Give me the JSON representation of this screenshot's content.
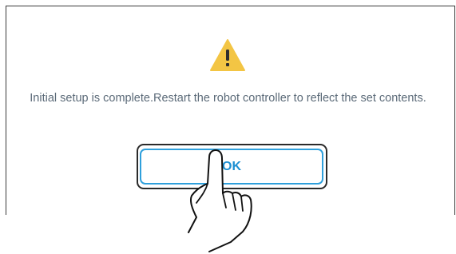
{
  "dialog": {
    "message": "Initial setup is complete.Restart the robot controller to reflect the set contents.",
    "ok_label": "OK",
    "icon": "warning-icon",
    "accent_color": "#1d8fd2",
    "warning_color": "#f3c544"
  },
  "overlay": {
    "icon": "hand-pointer-icon"
  }
}
